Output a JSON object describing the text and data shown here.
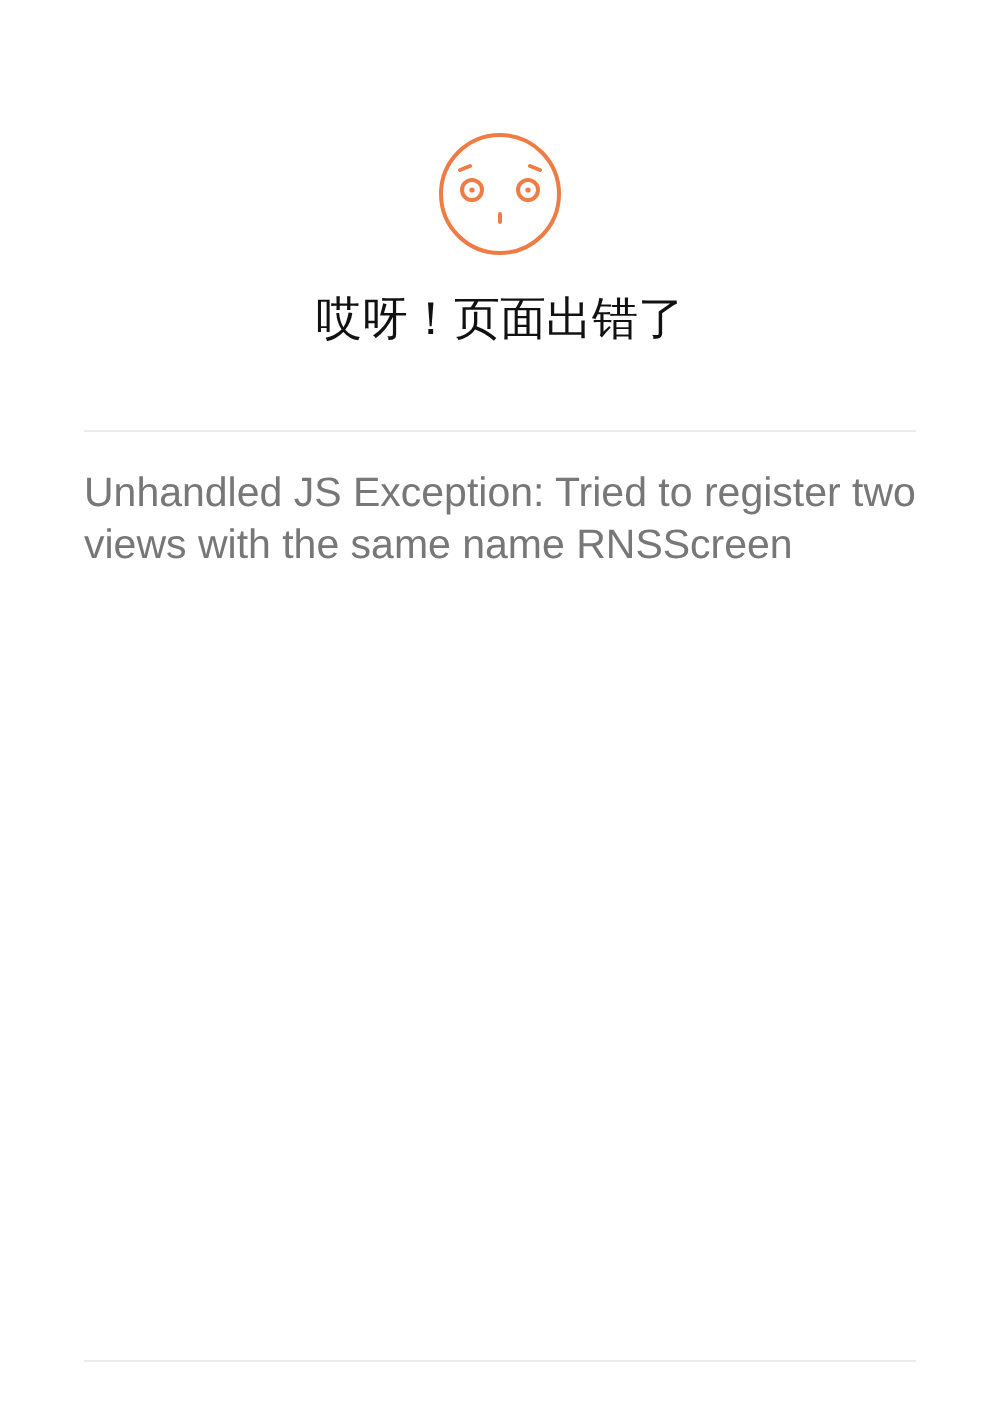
{
  "error_page": {
    "title": "哎呀！页面出错了",
    "message": "Unhandled JS Exception: Tried to register two views with the same name RNSScreen"
  }
}
